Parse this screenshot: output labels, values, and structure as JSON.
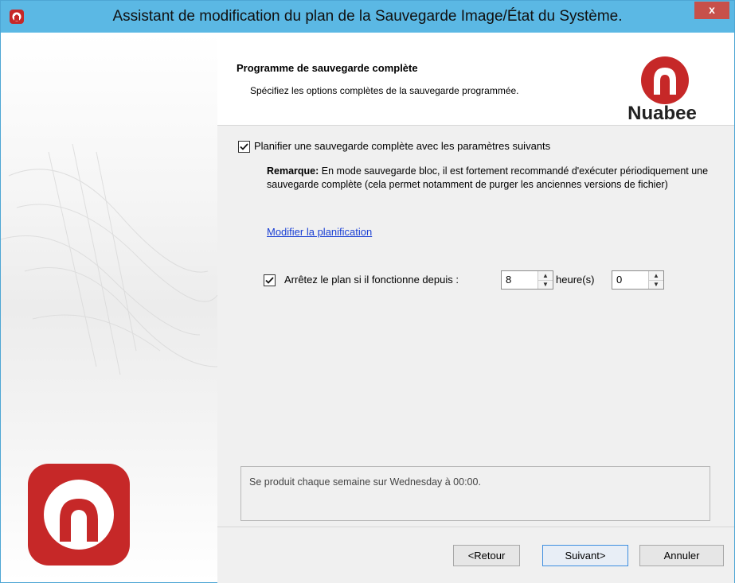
{
  "window": {
    "title": "Assistant de modification du plan de la Sauvegarde Image/État du Système.",
    "close_label": "x",
    "title_icon": "nuabee-app-icon",
    "title_bar_color": "#5bb8e4",
    "close_color": "#c7504a"
  },
  "header": {
    "title": "Programme de sauvegarde complète",
    "subtitle": "Spécifiez les options complètes de la sauvegarde programmée.",
    "brand_name": "Nuabee",
    "brand_color": "#c62828"
  },
  "options": {
    "schedule_full_checkbox_label": "Planifier une sauvegarde complète avec les paramètres suivants",
    "schedule_full_checked": true,
    "note_label": "Remarque:",
    "note_text": "En mode sauvegarde bloc, il est fortement recommandé d'exécuter périodiquement une sauvegarde complète (cela permet notamment de purger les anciennes versions de fichier)",
    "modify_link": "Modifier la planification",
    "stop_plan_label": "Arrêtez le plan si il fonctionne depuis :",
    "stop_plan_checked": true,
    "hours_value": "8",
    "hours_unit": "heure(s)",
    "minutes_value": "0"
  },
  "summary": {
    "text": "Se produit chaque semaine sur Wednesday à 00:00."
  },
  "footer": {
    "back_label": "<Retour",
    "next_label": "Suivant>",
    "cancel_label": "Annuler"
  }
}
